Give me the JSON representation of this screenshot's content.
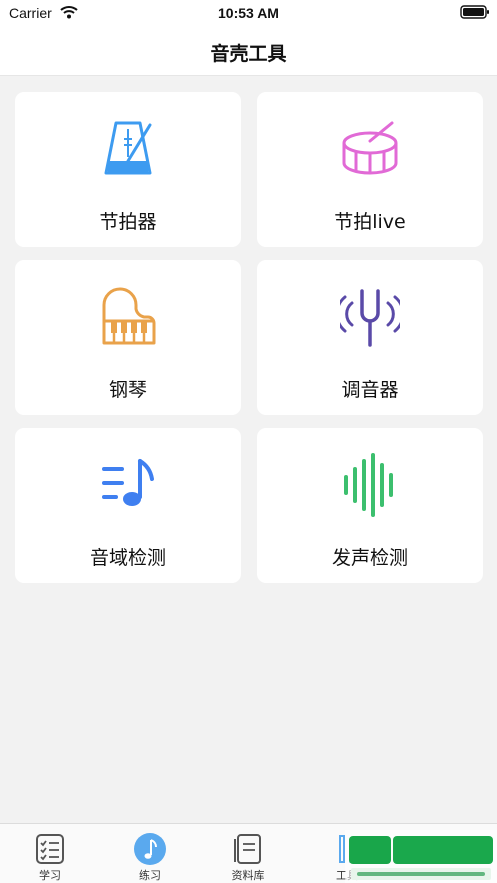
{
  "status_bar": {
    "carrier": "Carrier",
    "time": "10:53 AM"
  },
  "nav": {
    "title": "音壳工具"
  },
  "tools": [
    {
      "label": "节拍器",
      "icon": "metronome-icon",
      "color": "#3d9bf0"
    },
    {
      "label": "节拍live",
      "icon": "drum-icon",
      "color": "#e16ad6"
    },
    {
      "label": "钢琴",
      "icon": "piano-icon",
      "color": "#e9a24a"
    },
    {
      "label": "调音器",
      "icon": "tuning-fork-icon",
      "color": "#5a4aa8"
    },
    {
      "label": "音域检测",
      "icon": "music-note-list-icon",
      "color": "#3f7ff0"
    },
    {
      "label": "发声检测",
      "icon": "sound-wave-icon",
      "color": "#3cbf6e"
    }
  ],
  "tabs": [
    {
      "label": "学习",
      "icon": "checklist-icon"
    },
    {
      "label": "练习",
      "icon": "music-note-icon",
      "active_color": "#5aa9ee"
    },
    {
      "label": "资料库",
      "icon": "document-icon"
    },
    {
      "label": "工具",
      "icon": "tools-icon"
    }
  ]
}
